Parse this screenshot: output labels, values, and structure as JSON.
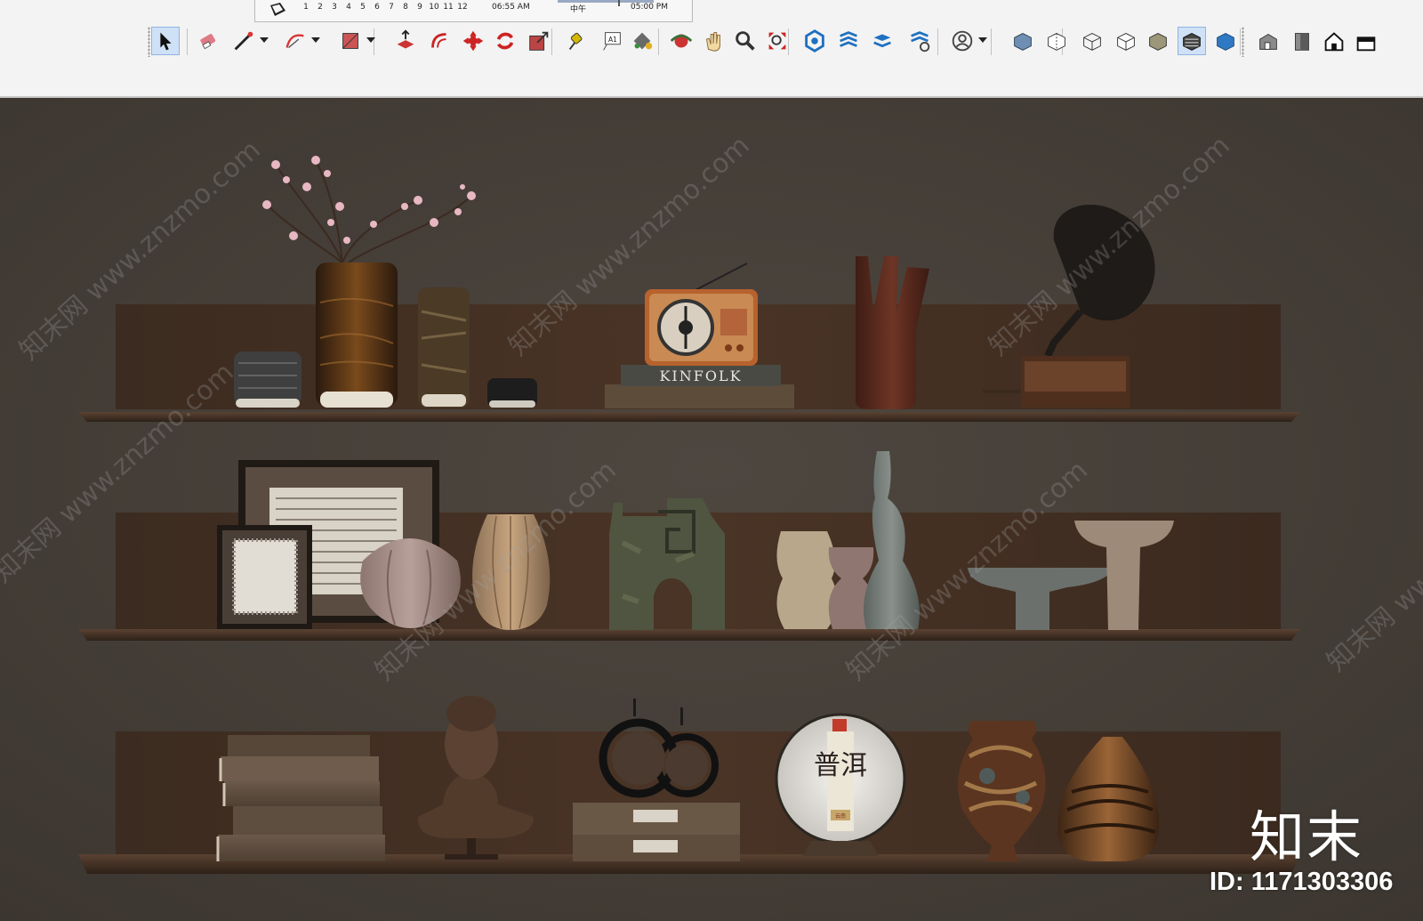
{
  "toolbar": {
    "shadow_settings": {
      "months": [
        "1",
        "2",
        "3",
        "4",
        "5",
        "6",
        "7",
        "8",
        "9",
        "10",
        "11",
        "12"
      ],
      "sunrise_time": "06:55 AM",
      "noon_label": "中午",
      "sunset_time": "05:00 PM"
    },
    "tools": [
      {
        "name": "select",
        "active": true
      },
      {
        "name": "eraser"
      },
      {
        "name": "line",
        "dropdown": true
      },
      {
        "name": "arc",
        "dropdown": true
      },
      {
        "name": "rectangle",
        "dropdown": true
      },
      {
        "name": "push-pull"
      },
      {
        "name": "offset"
      },
      {
        "name": "move"
      },
      {
        "name": "rotate"
      },
      {
        "name": "scale"
      },
      {
        "name": "tape-measure"
      },
      {
        "name": "text",
        "label": "A1"
      },
      {
        "name": "paint-bucket"
      },
      {
        "name": "orbit"
      },
      {
        "name": "pan"
      },
      {
        "name": "zoom"
      },
      {
        "name": "zoom-extents"
      },
      {
        "name": "3d-warehouse"
      },
      {
        "name": "extension-warehouse"
      },
      {
        "name": "layout"
      },
      {
        "name": "extension-manager"
      },
      {
        "name": "account",
        "dropdown": true
      },
      {
        "name": "x-ray"
      },
      {
        "name": "back-edges"
      },
      {
        "name": "wireframe"
      },
      {
        "name": "hidden-line"
      },
      {
        "name": "shaded"
      },
      {
        "name": "shaded-with-textures",
        "active": true
      },
      {
        "name": "monochrome"
      },
      {
        "name": "iso-view"
      },
      {
        "name": "top-view"
      },
      {
        "name": "front-view"
      },
      {
        "name": "right-view"
      }
    ]
  },
  "viewport": {
    "background_color": "#46403a",
    "shelf_color": "#3a2a1f",
    "book_spine_text": "KINFOLK",
    "tea_cake_text": "普洱",
    "tea_cake_small_text": "云南",
    "watermark": "知末网 www.znzmo.com",
    "logo": "知末",
    "image_id": "ID: 1171303306"
  }
}
